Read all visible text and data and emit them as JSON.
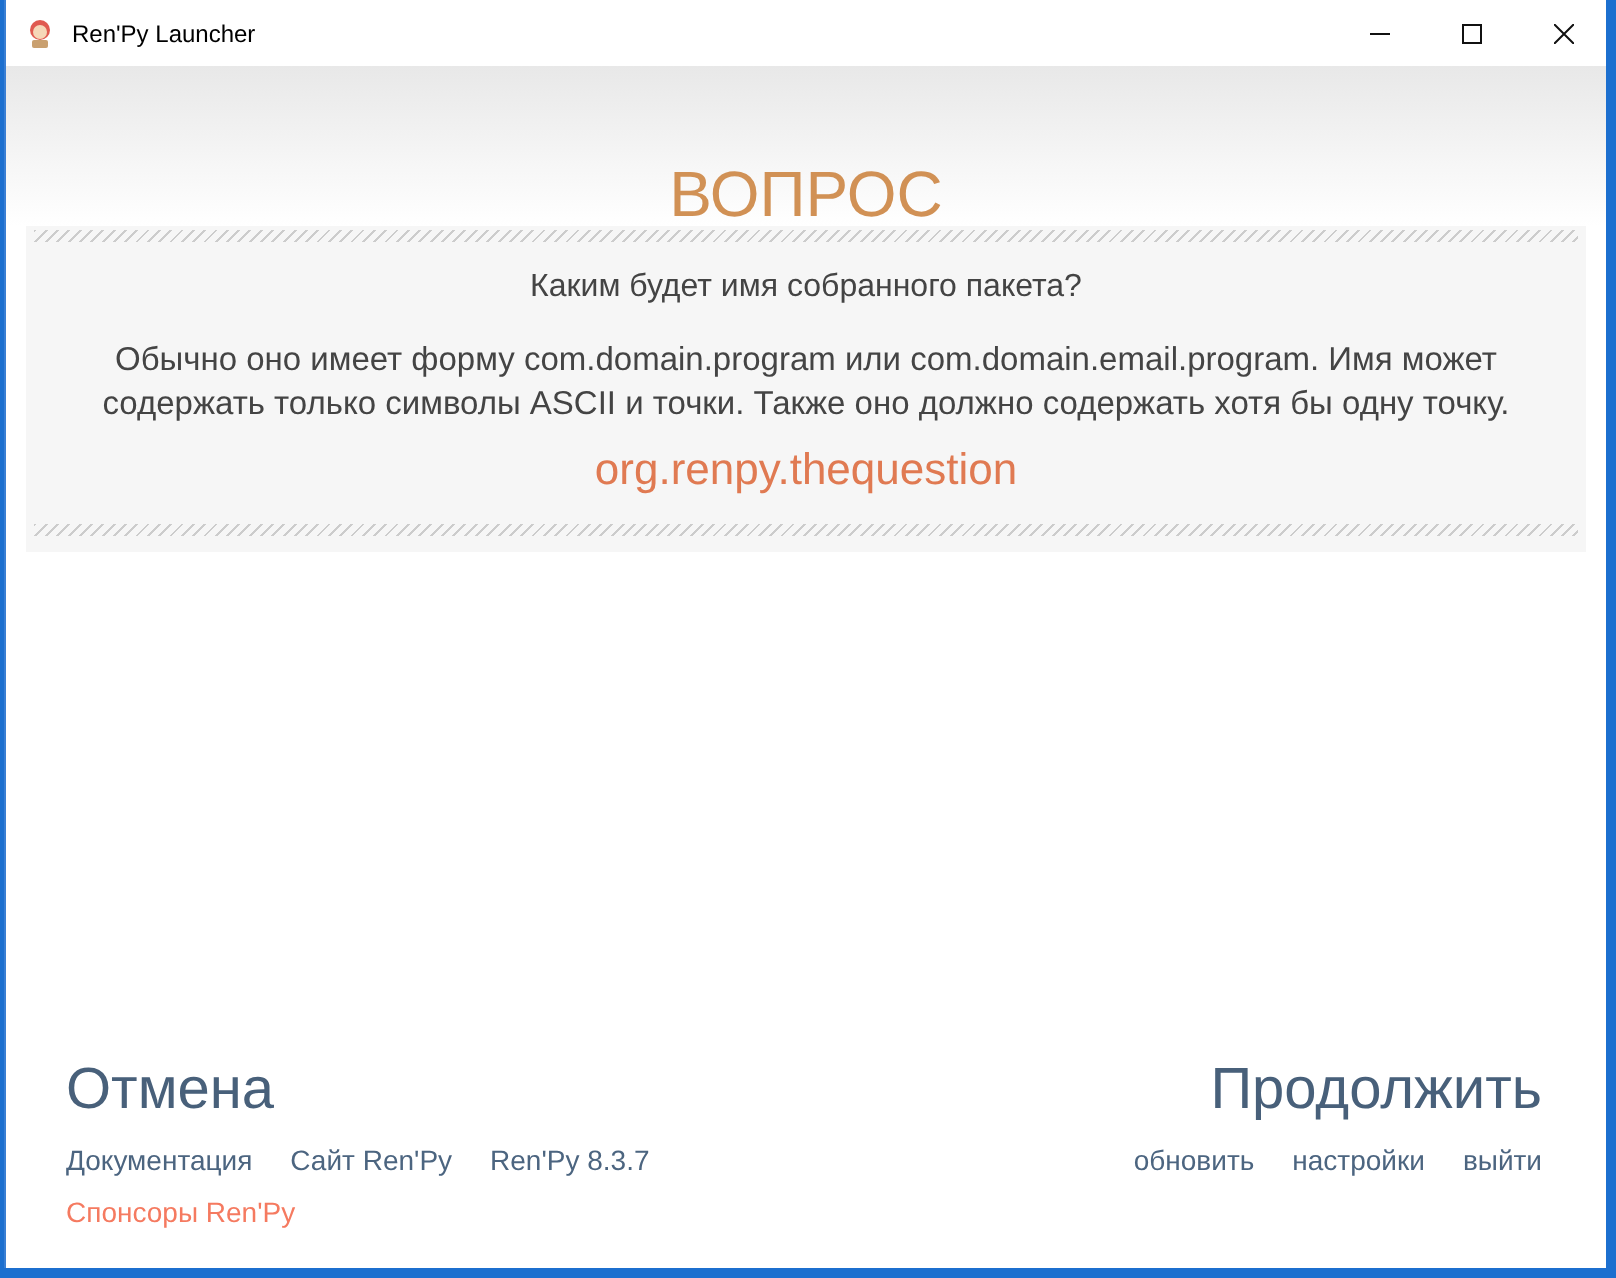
{
  "window": {
    "title": "Ren'Py Launcher"
  },
  "heading": "ВОПРОС",
  "panel": {
    "question": "Каким будет имя собранного пакета?",
    "description": "Обычно оно имеет форму com.domain.program или com.domain.email.program. Имя может содержать только символы ASCII и точки. Также оно должно содержать хотя бы одну точку.",
    "value": "org.renpy.thequestion"
  },
  "actions": {
    "cancel": "Отмена",
    "continue": "Продолжить"
  },
  "footer_left": [
    {
      "label": "Документация",
      "highlight": false
    },
    {
      "label": "Сайт Ren'Py",
      "highlight": false
    },
    {
      "label": "Ren'Py 8.3.7",
      "highlight": false
    }
  ],
  "footer_left_second": [
    {
      "label": "Спонсоры Ren'Py",
      "highlight": true
    }
  ],
  "footer_right": [
    "обновить",
    "настройки",
    "выйти"
  ]
}
